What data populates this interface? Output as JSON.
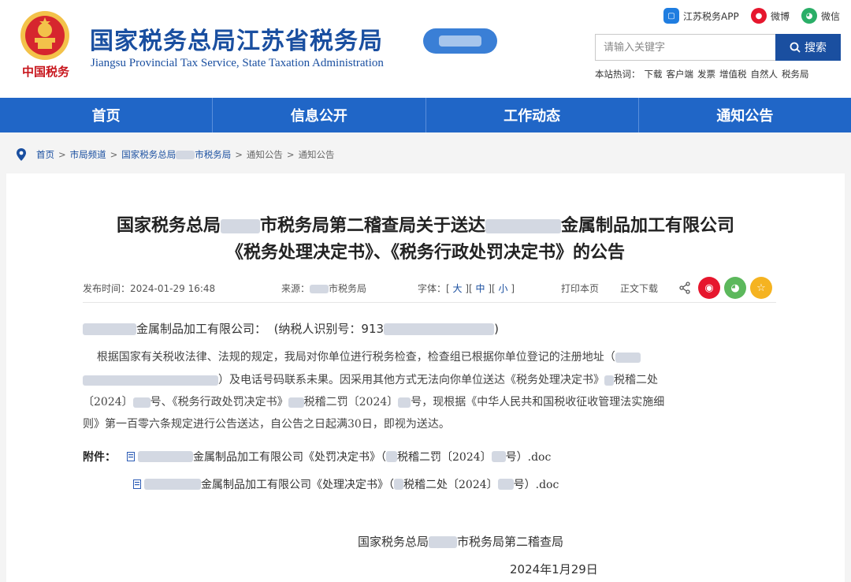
{
  "header": {
    "emblem_text": "中国税务",
    "title": "国家税务总局江苏省税务局",
    "subtitle": "Jiangsu Provincial Tax Service, State Taxation Administration",
    "social": [
      {
        "label": "江苏税务APP",
        "icon": "app-icon"
      },
      {
        "label": "微博",
        "icon": "weibo-icon"
      },
      {
        "label": "微信",
        "icon": "wechat-icon"
      }
    ],
    "search": {
      "placeholder": "请输入关键字",
      "button": "搜索"
    },
    "hot_label": "本站热词：",
    "hot_words": [
      "下载",
      "客户端",
      "发票",
      "增值税",
      "自然人",
      "税务局"
    ]
  },
  "nav": [
    "首页",
    "信息公开",
    "工作动态",
    "通知公告"
  ],
  "breadcrumb": {
    "items": [
      "首页",
      "市局频道",
      "国家税务总局",
      "市税务局",
      "通知公告",
      "通知公告"
    ]
  },
  "article": {
    "title_line1_a": "国家税务总局",
    "title_line1_b": "市税务局第二稽查局关于送达",
    "title_line1_c": "金属制品加工有限公司",
    "title_line2": "《税务处理决定书》、《税务行政处罚决定书》的公告",
    "publish_label": "发布时间：",
    "publish_time": "2024-01-29 16:48",
    "source_label": "来源：",
    "source_text": "市税务局",
    "font_label": "字体：",
    "font_large": "大",
    "font_medium": "中",
    "font_small": "小",
    "print": "打印本页",
    "download": "正文下载",
    "addressee_name": "金属制品加工有限公司：",
    "taxpayer_id_label": "(纳税人识别号：",
    "taxpayer_id_prefix": "913",
    "taxpayer_id_close": ")",
    "p1": "根据国家有关税收法律、法规的规定，我局对你单位进行税务检查，检查组已根据你单位登记的注册地址（",
    "p2": "）及电话号码联系未果。因采用其他方式无法向你单位送达《税务处理决定书》",
    "p2_tail": "税稽二处",
    "p3_a": "〔2024〕",
    "p3_b": "号、《税务行政处罚决定书》",
    "p3_c": "税稽二罚〔2024〕",
    "p3_d": "号，现根据《中华人民共和国税收征收管理法实施细",
    "p4": "则》第一百零六条规定进行公告送达，自公告之日起满30日，即视为送达。",
    "attachment_label": "附件：",
    "attachments": [
      {
        "a": "金属制品加工有限公司《处罚决定书》（",
        "b": "税稽二罚〔2024〕",
        "c": "号）.doc"
      },
      {
        "a": "金属制品加工有限公司《处理决定书》（",
        "b": "税稽二处〔2024〕",
        "c": "号）.doc"
      }
    ],
    "signature_a": "国家税务总局",
    "signature_b": "市税务局第二稽查局",
    "date": "2024年1月29日"
  },
  "colors": {
    "brand_blue": "#1a4fa0",
    "nav_blue": "#2066c7",
    "weibo_red": "#e6162d",
    "wechat_green": "#2aae67",
    "favorite_yellow": "#f5b321"
  }
}
